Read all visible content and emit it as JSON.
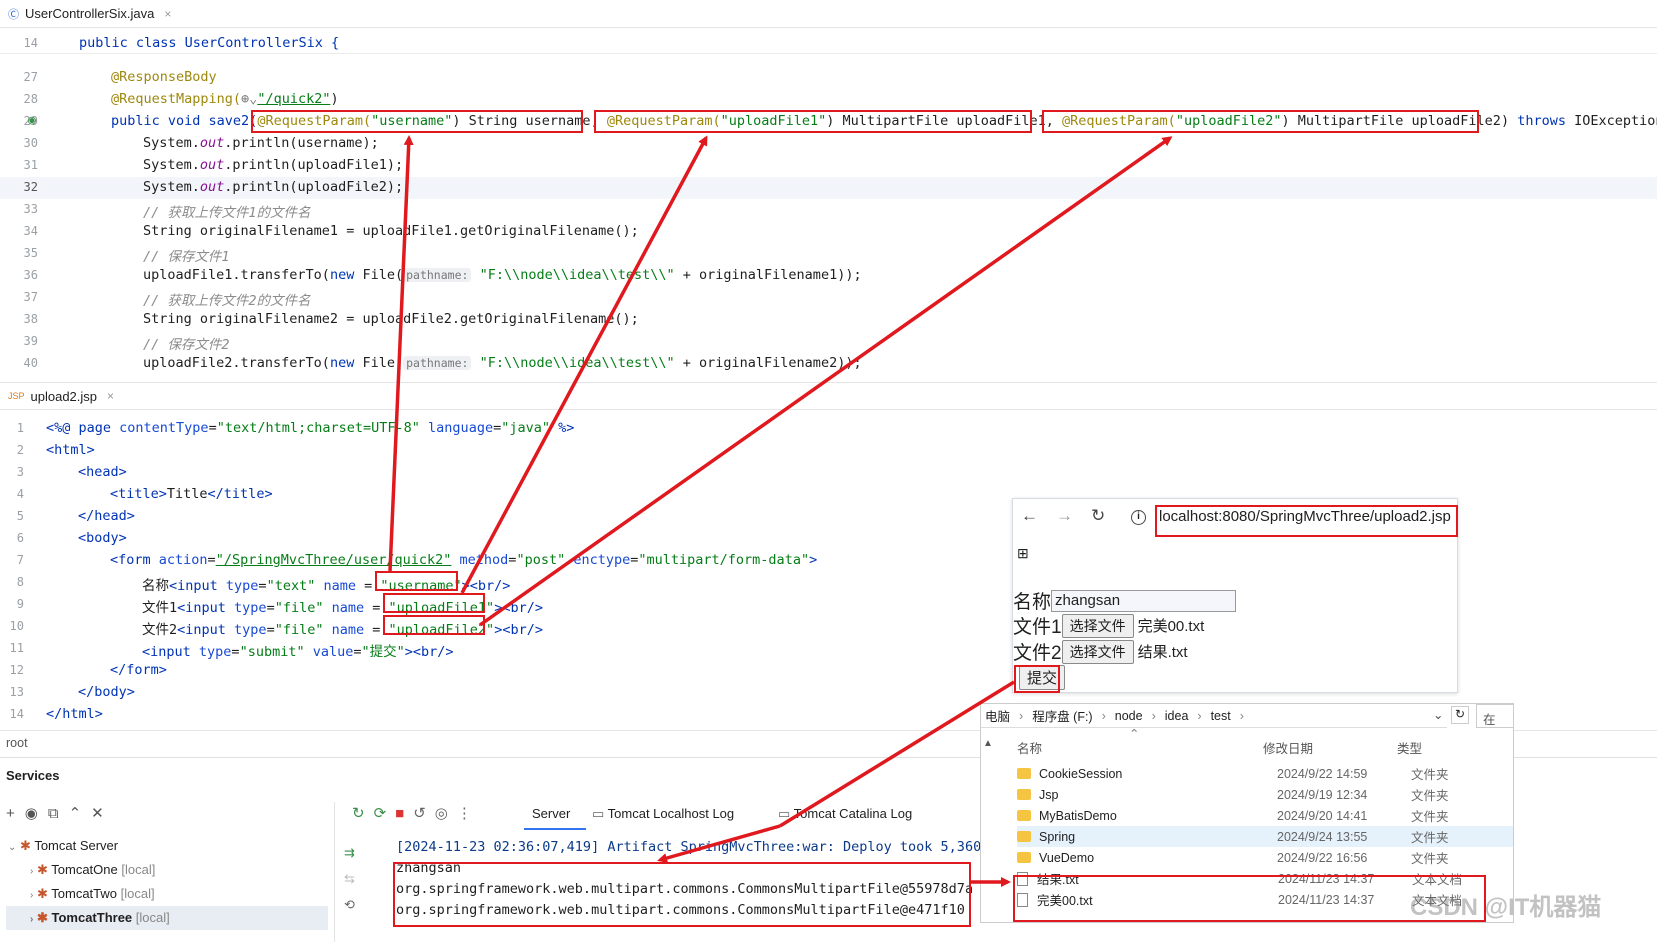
{
  "java_tab": {
    "icon": "Ⓒ",
    "title": "UserControllerSix.java",
    "close": "×"
  },
  "java_lines": {
    "n14": "14",
    "l14": "public class UserControllerSix {",
    "n27": "27",
    "n28": "28",
    "n29": "29",
    "n30": "30",
    "n31": "31",
    "n32": "32",
    "n33": "33",
    "n34": "34",
    "n35": "35",
    "n36": "36",
    "n37": "37",
    "n38": "38",
    "n39": "39",
    "n40": "40",
    "responseBody": "@ResponseBody",
    "requestMapping": "@RequestMapping(",
    "mappingPath": "\"/quick2\"",
    "rp": "@RequestParam(",
    "p1name": "\"username\"",
    "p1type": ") String username",
    "p2name": "\"uploadFile1\"",
    "p2type": ") MultipartFile uploadFile1",
    "p3name": "\"uploadFile2\"",
    "p3type": ") MultipartFile uploadFile2",
    "sigStart": "public void save2(",
    "throws": "throws",
    "throwsRest": " IOException {",
    "l30": "System.",
    "out": "out",
    "l30b": ".println(username);",
    "l31b": ".println(uploadFile1);",
    "l32b": ".println(uploadFile2);",
    "c33": "// 获取上传文件1的文件名",
    "l34": "String originalFilename1 = uploadFile1.getOriginalFilename();",
    "c35": "// 保存文件1",
    "l36a": "uploadFile1.transferTo(",
    "new": "new",
    "l36b": " File(",
    "hint": "pathname:",
    "path": "\"F:\\\\node\\\\idea\\\\test\\\\\"",
    "l36c": " + originalFilename1));",
    "c37": "// 获取上传文件2的文件名",
    "l38": "String originalFilename2 = uploadFile2.getOriginalFilename();",
    "c39": "// 保存文件2",
    "l40a": "uploadFile2.transferTo(",
    "l40c": " + originalFilename2));"
  },
  "jsp_tab": {
    "icon": "JSP",
    "title": "upload2.jsp",
    "close": "×"
  },
  "jsp_lines": {
    "n1": "1",
    "n2": "2",
    "n3": "3",
    "n4": "4",
    "n5": "5",
    "n6": "6",
    "n7": "7",
    "n8": "8",
    "n9": "9",
    "n10": "10",
    "n11": "11",
    "n12": "12",
    "n13": "13",
    "n14": "14",
    "l1a": "<%@ ",
    "l1b": "page",
    "l1c": " contentType",
    "l1d": "=",
    "l1e": "\"text/html;charset=UTF-8\"",
    "l1f": " language",
    "l1g": "\"java\"",
    "l1h": " %>",
    "l2": "<html>",
    "l3": "<head>",
    "l4a": "<title>",
    "l4b": "Title",
    "l4c": "</title>",
    "l5": "</head>",
    "l6": "<body>",
    "l7a": "<form",
    "l7b": " action",
    "l7c": "\"/SpringMvcThree/user/quick2\"",
    "l7d": " method",
    "l7e": "\"post\"",
    "l7f": " enctype",
    "l7g": "\"multipart/form-data\"",
    "l7h": ">",
    "l8a": "名称",
    "l8b": "<input",
    "l8c": " type",
    "l8d": "\"text\"",
    "l8e": " name",
    "l8f": " = ",
    "l8g": "\"username\"",
    "l8h": "><br/>",
    "l9a": "文件1",
    "l9d": "\"file\"",
    "l9g": "\"uploadFile1\"",
    "l10a": "文件2",
    "l10g": "\"uploadFile2\"",
    "l11d": "\"submit\"",
    "l11e": " value",
    "l11g": "\"提交\"",
    "l12": "</form>",
    "l13": "</body>",
    "l14": "</html>"
  },
  "breadcrumb": "root",
  "services": {
    "title": "Services",
    "tomcat_server": "Tomcat Server",
    "servers": [
      {
        "name": "TomcatOne",
        "tag": "[local]"
      },
      {
        "name": "TomcatTwo",
        "tag": "[local]"
      },
      {
        "name": "TomcatThree",
        "tag": "[local]"
      }
    ],
    "tabs": {
      "server": "Server",
      "localhost_log": "Tomcat Localhost Log",
      "catalina_log": "Tomcat Catalina Log"
    }
  },
  "console": {
    "deploy": "[2024-11-23 02:36:07,419] Artifact SpringMvcThree:war: Deploy took 5,360",
    "out1": "zhangsan",
    "out2": "org.springframework.web.multipart.commons.CommonsMultipartFile@55978d7a",
    "out3": "org.springframework.web.multipart.commons.CommonsMultipartFile@e471f10"
  },
  "browser": {
    "url": "localhost:8080/SpringMvcThree/upload2.jsp",
    "label_name": "名称",
    "name_value": "zhangsan",
    "label_file1": "文件1",
    "label_file2": "文件2",
    "choose_file": "选择文件",
    "file1": "完美00.txt",
    "file2": "结果.txt",
    "submit": "提交"
  },
  "explorer": {
    "crumbs": [
      "电脑",
      "程序盘 (F:)",
      "node",
      "idea",
      "test"
    ],
    "search": "在",
    "headers": {
      "name": "名称",
      "date": "修改日期",
      "type": "类型"
    },
    "rows": [
      {
        "name": "CookieSession",
        "date": "2024/9/22 14:59",
        "type": "文件夹"
      },
      {
        "name": "Jsp",
        "date": "2024/9/19 12:34",
        "type": "文件夹"
      },
      {
        "name": "MyBatisDemo",
        "date": "2024/9/20 14:41",
        "type": "文件夹"
      },
      {
        "name": "Spring",
        "date": "2024/9/24 13:55",
        "type": "文件夹"
      },
      {
        "name": "VueDemo",
        "date": "2024/9/22 16:56",
        "type": "文件夹"
      },
      {
        "name": "结果.txt",
        "date": "2024/11/23 14:37",
        "type": "文本文档"
      },
      {
        "name": "完美00.txt",
        "date": "2024/11/23 14:37",
        "type": "文本文档"
      }
    ]
  },
  "watermark": "CSDN @IT机器猫",
  "colors": {
    "annotation_red": "#e0191e",
    "keyword": "#0033b3",
    "string": "#067d17"
  }
}
